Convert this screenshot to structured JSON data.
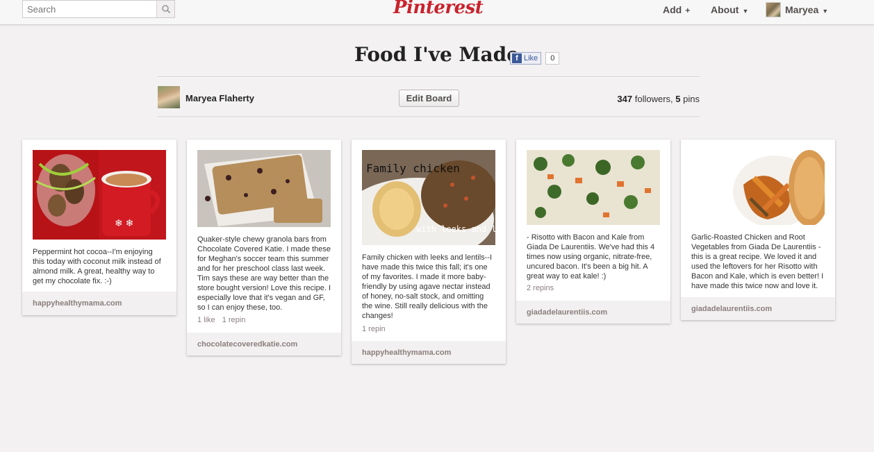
{
  "topbar": {
    "search_placeholder": "Search",
    "logo": "Pinterest",
    "nav": {
      "add": "Add",
      "about": "About",
      "user": "Maryea"
    }
  },
  "board": {
    "title": "Food I've Made",
    "fb_like_label": "Like",
    "fb_like_count": "0",
    "owner": "Maryea Flaherty",
    "edit_button": "Edit Board",
    "followers_count": "347",
    "followers_label": "followers,",
    "pins_count": "5",
    "pins_label": "pins"
  },
  "pins": [
    {
      "description": "Peppermint hot cocoa--I'm enjoying this today with coconut milk instead of almond milk. A great, healthy way to get my chocolate fix. :-)",
      "likes": "",
      "repins": "",
      "source": "happyhealthymama.com",
      "image_label": ""
    },
    {
      "description": "Quaker-style chewy granola bars from Chocolate Covered Katie. I made these for Meghan's soccer team this summer and for her preschool class last week. Tim says these are way better than the store bought version! Love this recipe. I especially love that it's vegan and GF, so I can enjoy these, too.",
      "likes": "1 like",
      "repins": "1 repin",
      "source": "chocolatecoveredkatie.com",
      "image_label": ""
    },
    {
      "description": "Family chicken with leeks and lentils--I have made this twice this fall; it's one of my favorites. I made it more baby-friendly by using agave nectar instead of honey, no-salt stock, and omitting the wine. Still really delicious with the changes!",
      "likes": "",
      "repins": "1 repin",
      "source": "happyhealthymama.com",
      "image_label": "Family chicken",
      "image_label2": "with leeks and lentils"
    },
    {
      "description": "- Risotto with Bacon and Kale from Giada De Laurentiis. We've had this 4 times now using organic, nitrate-free, uncured bacon. It's been a big hit. A great way to eat kale! :)",
      "likes": "",
      "repins": "2 repins",
      "source": "giadadelaurentiis.com",
      "image_label": ""
    },
    {
      "description": "Garlic-Roasted Chicken and Root Vegetables from Giada De Laurentiis - this is a great recipe. We loved it and used the leftovers for her Risotto with Bacon and Kale, which is even better! I have made this twice now and love it.",
      "likes": "",
      "repins": "",
      "source": "giadadelaurentiis.com",
      "image_label": ""
    }
  ],
  "colors": {
    "brand_red": "#c8232c",
    "background": "#f3f1f1",
    "facebook_blue": "#3b5998"
  },
  "icons": [
    "search-icon",
    "plus-icon",
    "chevron-down-icon",
    "facebook-icon"
  ]
}
